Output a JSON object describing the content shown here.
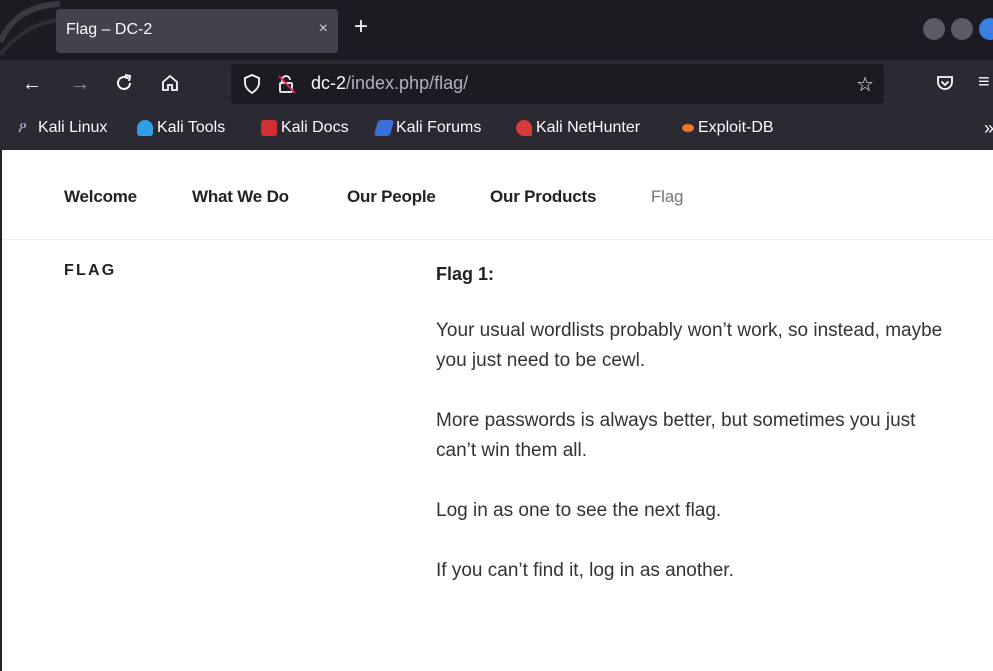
{
  "browser": {
    "tab_title": "Flag – DC-2",
    "tab_close": "×",
    "new_tab": "+",
    "url_host": "dc-2",
    "url_path": "/index.php/flag/"
  },
  "bookmarks": [
    {
      "label": "Kali Linux",
      "icon": "kali-dragon-icon",
      "color": "#3c8ad8"
    },
    {
      "label": "Kali Tools",
      "icon": "kali-tools-icon",
      "color": "#2f9ee6"
    },
    {
      "label": "Kali Docs",
      "icon": "kali-docs-icon",
      "color": "#d42f2f"
    },
    {
      "label": "Kali Forums",
      "icon": "kali-forums-icon",
      "color": "#3a6fd8"
    },
    {
      "label": "Kali NetHunter",
      "icon": "kali-nethunter-icon",
      "color": "#d63a3a"
    },
    {
      "label": "Exploit-DB",
      "icon": "exploit-db-icon",
      "color": "#e8772e"
    }
  ],
  "site_nav": {
    "items": [
      "Welcome",
      "What We Do",
      "Our People",
      "Our Products",
      "Flag"
    ]
  },
  "page": {
    "title": "FLAG",
    "flag_heading": "Flag 1:",
    "paragraphs": [
      "Your usual wordlists probably won’t work, so instead, maybe you just need to be cewl.",
      "More passwords is always better, but sometimes you just can’t win them all.",
      "Log in as one to see the next flag.",
      "If you can’t find it, log in as another."
    ]
  }
}
